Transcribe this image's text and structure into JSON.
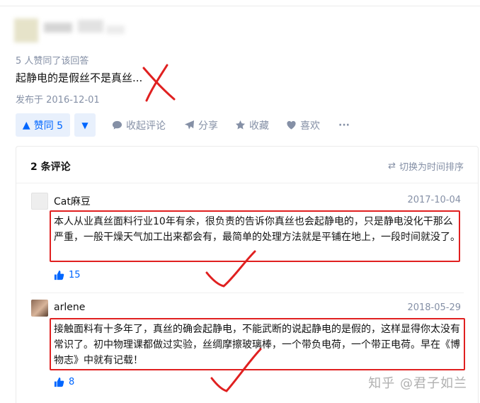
{
  "answer": {
    "upvoted_by": "5 人赞同了该回答",
    "text": "起静电的是假丝不是真丝...",
    "published": "发布于 2016-12-01"
  },
  "actions": {
    "vote_up_label": "赞同 5",
    "collapse_comments": "收起评论",
    "share": "分享",
    "collect": "收藏",
    "like": "喜欢",
    "more": "···"
  },
  "comments": {
    "count_label": "2 条评论",
    "sort_toggle": "切换为时间排序",
    "items": [
      {
        "author": "Cat麻豆",
        "date": "2017-10-04",
        "text": "本人从业真丝面料行业10年有余，很负责的告诉你真丝也会起静电的，只是静电没化干那么严重，一般干燥天气加工出来都会有，最简单的处理方法就是平铺在地上，一段时间就没了。",
        "likes": "15"
      },
      {
        "author": "arlene",
        "date": "2018-05-29",
        "text": "接触面料有十多年了，真丝的确会起静电，不能武断的说起静电的是假的，这样显得你太没有常识了。初中物理课都做过实验，丝绸摩擦玻璃棒，一个带负电荷，一个带正电荷。早在《博物志》中就有记载！",
        "likes": "8"
      }
    ]
  },
  "watermark": "知乎 @君子如兰",
  "colors": {
    "accent": "#0066ff",
    "annotation": "#e02020",
    "muted": "#8590a6"
  }
}
